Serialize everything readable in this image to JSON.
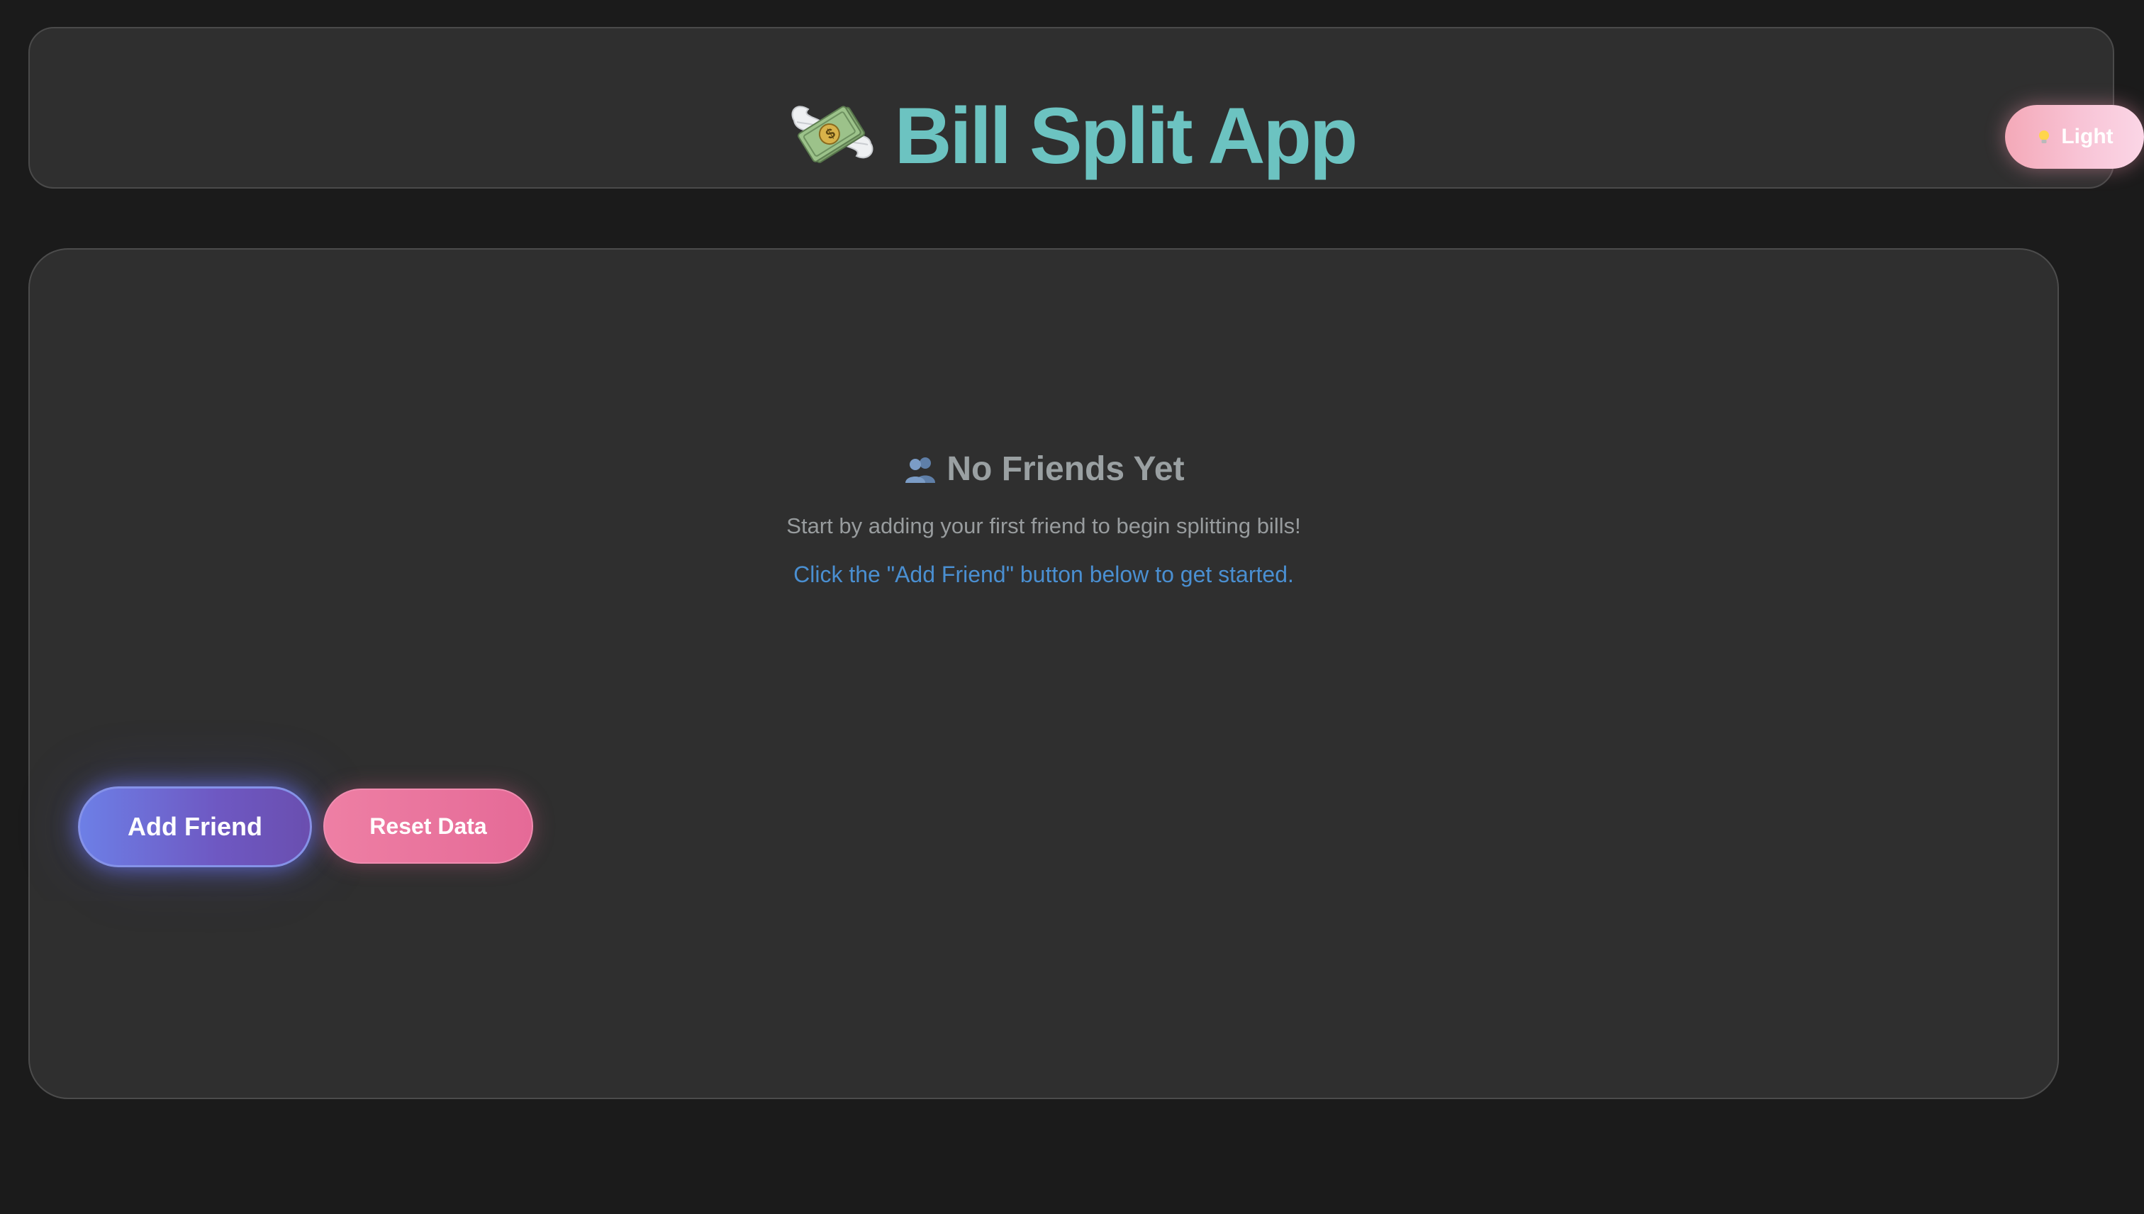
{
  "app": {
    "title": "Bill Split App",
    "title_icon": "money-with-wings-icon",
    "title_color": "#6cc3c1"
  },
  "theme_toggle": {
    "label": "Light",
    "icon": "light-bulb-icon"
  },
  "empty_state": {
    "icon": "people-icon",
    "heading": "No Friends Yet",
    "message": "Start by adding your first friend to begin splitting bills!",
    "hint": "Click the \"Add Friend\" button below to get started.",
    "hint_color": "#4a8fd1"
  },
  "actions": {
    "add_friend_label": "Add Friend",
    "reset_label": "Reset Data"
  },
  "colors": {
    "background": "#1b1b1b",
    "card": "#2f2f2f",
    "add_button": "#6e6cd6",
    "reset_button": "#e97199",
    "toggle": "#f7b8cb"
  }
}
